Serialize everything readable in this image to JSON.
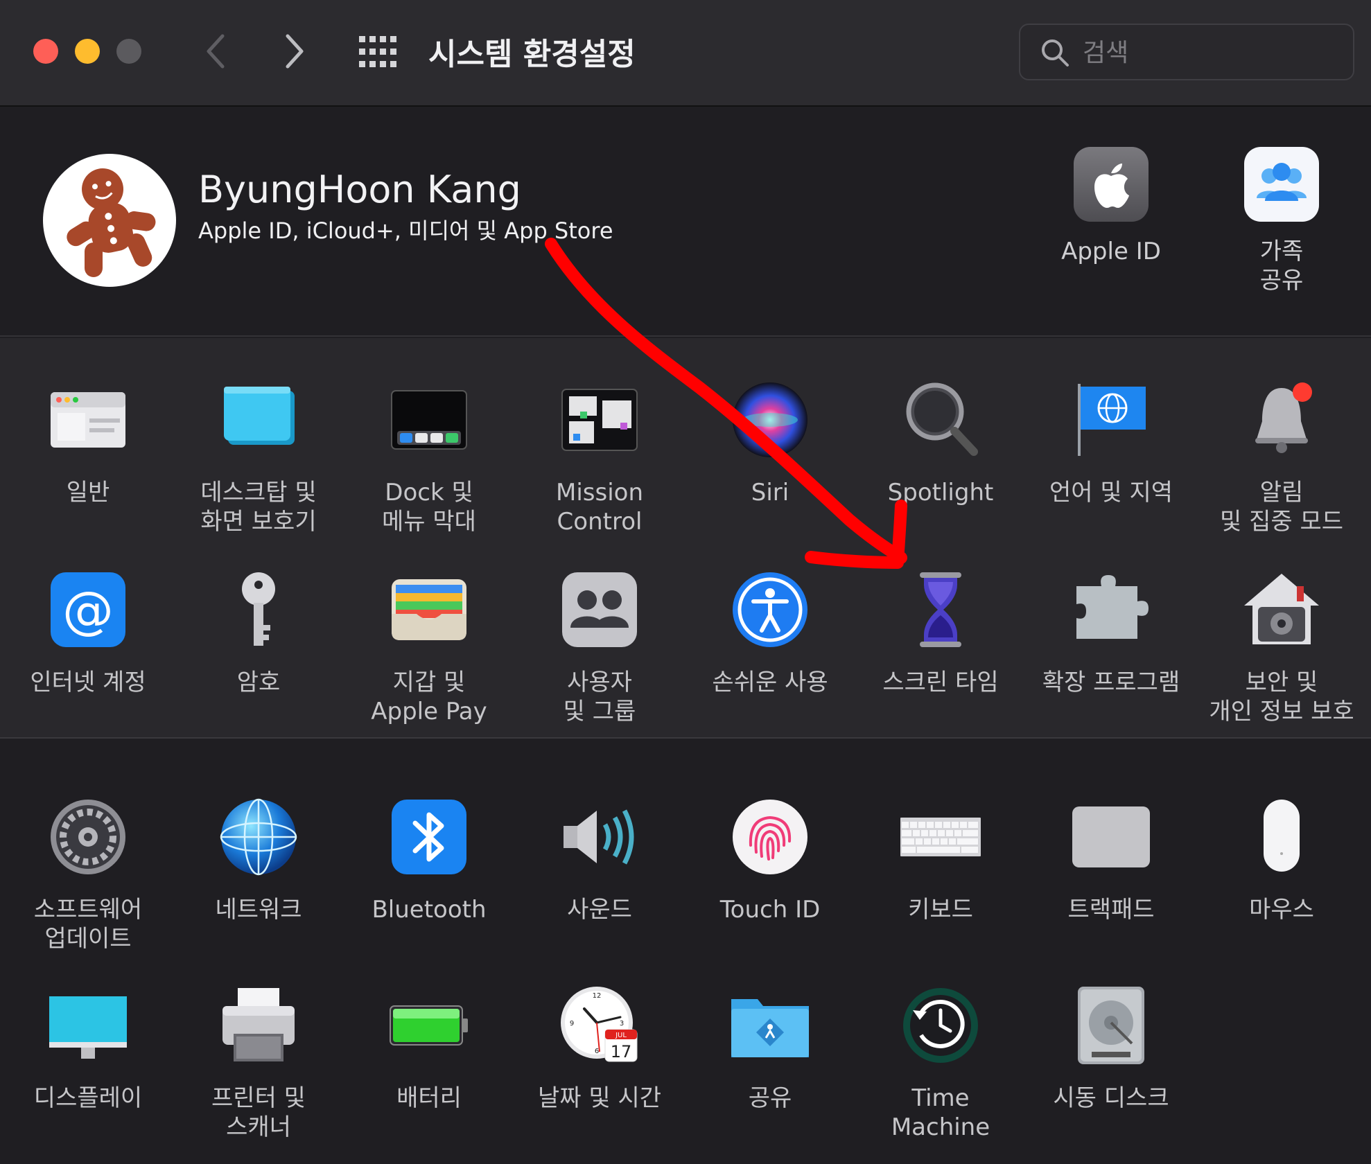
{
  "window": {
    "title": "시스템 환경설정",
    "search_placeholder": "검색"
  },
  "account": {
    "name": "ByungHoon Kang",
    "subtitle": "Apple ID, iCloud+, 미디어 및 App Store",
    "apple_id_label": "Apple ID",
    "family_label": "가족\n공유"
  },
  "row1": [
    {
      "label": "일반"
    },
    {
      "label": "데스크탑 및\n화면 보호기"
    },
    {
      "label": "Dock 및\n메뉴 막대"
    },
    {
      "label": "Mission\nControl"
    },
    {
      "label": "Siri"
    },
    {
      "label": "Spotlight"
    },
    {
      "label": "언어 및 지역"
    },
    {
      "label": "알림\n및 집중 모드"
    }
  ],
  "row2": [
    {
      "label": "인터넷 계정"
    },
    {
      "label": "암호"
    },
    {
      "label": "지갑 및\nApple Pay"
    },
    {
      "label": "사용자\n및 그룹"
    },
    {
      "label": "손쉬운 사용"
    },
    {
      "label": "스크린 타임"
    },
    {
      "label": "확장 프로그램"
    },
    {
      "label": "보안 및\n개인 정보 보호"
    }
  ],
  "row3": [
    {
      "label": "소프트웨어\n업데이트"
    },
    {
      "label": "네트워크"
    },
    {
      "label": "Bluetooth"
    },
    {
      "label": "사운드"
    },
    {
      "label": "Touch ID"
    },
    {
      "label": "키보드"
    },
    {
      "label": "트랙패드"
    },
    {
      "label": "마우스"
    }
  ],
  "row4": [
    {
      "label": "디스플레이"
    },
    {
      "label": "프린터 및\n스캐너"
    },
    {
      "label": "배터리"
    },
    {
      "label": "날짜 및 시간"
    },
    {
      "label": "공유"
    },
    {
      "label": "Time\nMachine"
    },
    {
      "label": "시동 디스크"
    }
  ],
  "clock": {
    "month": "JUL",
    "day": "17"
  },
  "colors": {
    "annotation_arrow": "#ff0000",
    "accent_blue": "#1e7cf2"
  }
}
